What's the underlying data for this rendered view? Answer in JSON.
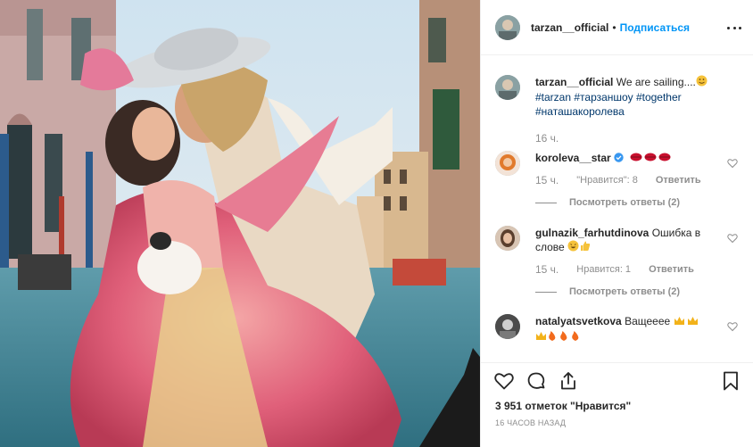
{
  "post": {
    "username": "tarzan__official",
    "follow_label": "Подписаться",
    "dot": "•"
  },
  "caption": {
    "username": "tarzan__official",
    "text": "We are sailing....",
    "tags": [
      "#tarzan",
      "#тарзаншоу",
      "#together",
      "#наташакоролева"
    ],
    "time": "16 ч."
  },
  "comments": [
    {
      "username": "koroleva__star",
      "text": "",
      "time": "15 ч.",
      "likes": "\"Нравится\": 8",
      "reply": "Ответить",
      "view_replies": "Посмотреть ответы (2)"
    },
    {
      "username": "gulnazik_farhutdinova",
      "text": "Ошибка в слове",
      "time": "15 ч.",
      "likes": "Нравится: 1",
      "reply": "Ответить",
      "view_replies": "Посмотреть ответы (2)"
    },
    {
      "username": "natalyatsvetkova",
      "text": "Ващееее",
      "time": "",
      "likes": "",
      "reply": "",
      "view_replies": ""
    }
  ],
  "footer": {
    "likes_count": "3 951 отметок \"Нравится\"",
    "posted_ago": "16 ЧАСОВ НАЗАД"
  },
  "icons": {
    "like": "heart-icon",
    "comment": "comment-icon",
    "share": "share-icon",
    "save": "bookmark-icon",
    "more": "more-icon"
  },
  "colors": {
    "link": "#00376b",
    "follow": "#0095f6",
    "muted": "#8e8e8e",
    "verified": "#3897f0"
  }
}
